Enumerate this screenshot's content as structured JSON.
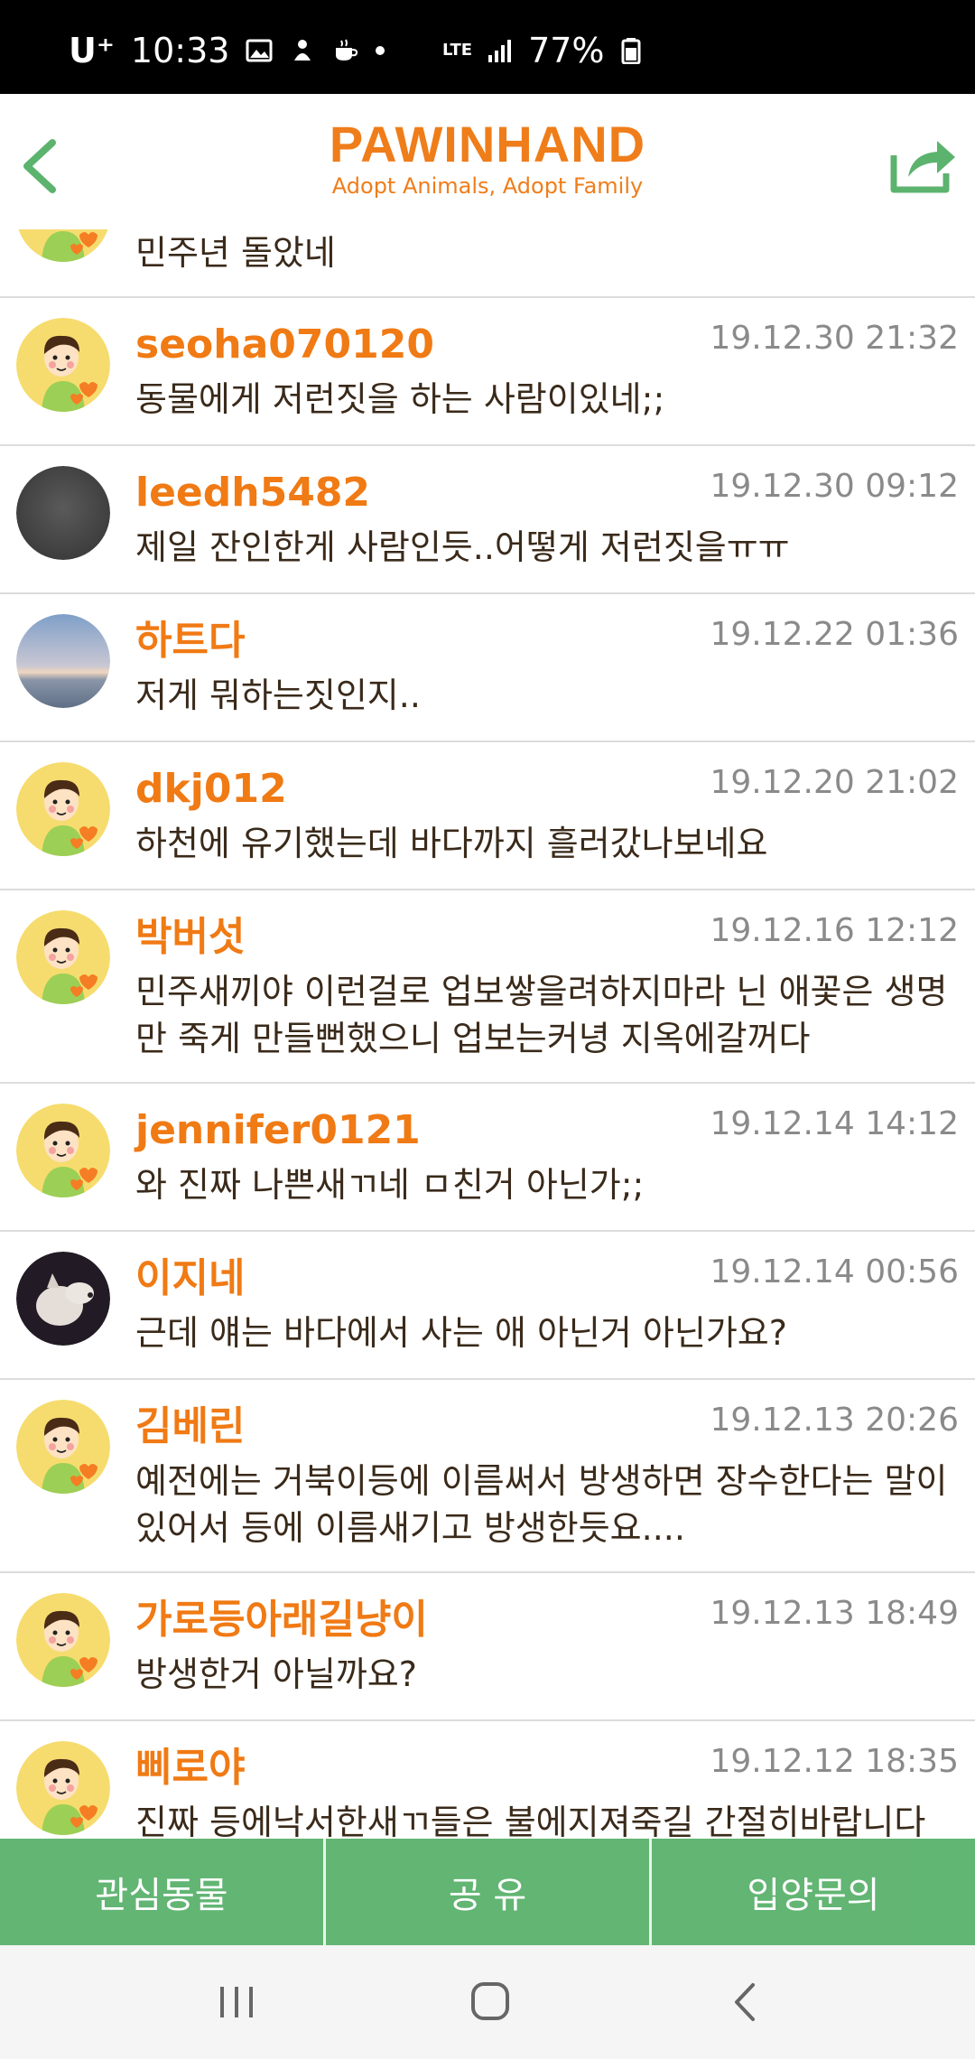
{
  "status_bar": {
    "carrier": "U⁺",
    "time": "10:33",
    "network": "LTE",
    "battery": "77%",
    "icons": [
      "image-icon",
      "notification-icon",
      "coffee-icon",
      "dot-icon",
      "signal-icon",
      "battery-icon"
    ]
  },
  "header": {
    "title": "PAWINHAND",
    "subtitle": "Adopt Animals, Adopt Family",
    "back_icon": "chevron-left-icon",
    "share_icon": "share-icon"
  },
  "colors": {
    "brand_orange": "#ef7d1a",
    "green": "#5cb36e",
    "timestamp_gray": "#8a8a8a",
    "divider": "#dcdcdc"
  },
  "comments": [
    {
      "name": "",
      "time": "",
      "text": "민주년 돌았네",
      "avatar": "cartoon-avatar"
    },
    {
      "name": "seoha070120",
      "time": "19.12.30 21:32",
      "text": "동물에게 저런짓을 하는 사람이있네;;",
      "avatar": "cartoon-avatar"
    },
    {
      "name": "leedh5482",
      "time": "19.12.30 09:12",
      "text": "제일 잔인한게 사람인듯..어떻게 저런짓을ㅠㅠ",
      "avatar": "dark-photo-avatar"
    },
    {
      "name": "하트다",
      "time": "19.12.22 01:36",
      "text": "저게 뭐하는짓인지..",
      "avatar": "sky-photo-avatar"
    },
    {
      "name": "dkj012",
      "time": "19.12.20 21:02",
      "text": "하천에 유기했는데 바다까지 흘러갔나보네요",
      "avatar": "cartoon-avatar"
    },
    {
      "name": "박버섯",
      "time": "19.12.16 12:12",
      "text": "민주새끼야 이런걸로 업보쌓을려하지마라 닌 애꽃은 생명만 죽게 만들뻔했으니 업보는커녕 지옥에갈꺼다",
      "avatar": "cartoon-avatar"
    },
    {
      "name": "jennifer0121",
      "time": "19.12.14 14:12",
      "text": "와 진짜 나쁜새ㄲ네 ㅁ친거 아닌가;;",
      "avatar": "cartoon-avatar"
    },
    {
      "name": "이지네",
      "time": "19.12.14 00:56",
      "text": "근데 얘는 바다에서 사는 애 아닌거 아닌가요?",
      "avatar": "dog-photo-avatar"
    },
    {
      "name": "김베린",
      "time": "19.12.13 20:26",
      "text": "예전에는 거북이등에 이름써서 방생하면 장수한다는 말이 있어서 등에 이름새기고 방생한듯요....",
      "avatar": "cartoon-avatar"
    },
    {
      "name": "가로등아래길냥이",
      "time": "19.12.13 18:49",
      "text": "방생한거 아닐까요?",
      "avatar": "cartoon-avatar"
    },
    {
      "name": "삐로야",
      "time": "19.12.12 18:35",
      "text": "진짜 등에낙서한새ㄲ들은 불에지져죽길 간절히바랍니다",
      "avatar": "cartoon-avatar"
    }
  ],
  "action_bar": {
    "favorite_label": "관심동물",
    "share_label": "공 유",
    "adopt_label": "입양문의"
  },
  "nav_bar": {
    "icons": [
      "recent-apps-icon",
      "home-icon",
      "back-icon"
    ]
  }
}
